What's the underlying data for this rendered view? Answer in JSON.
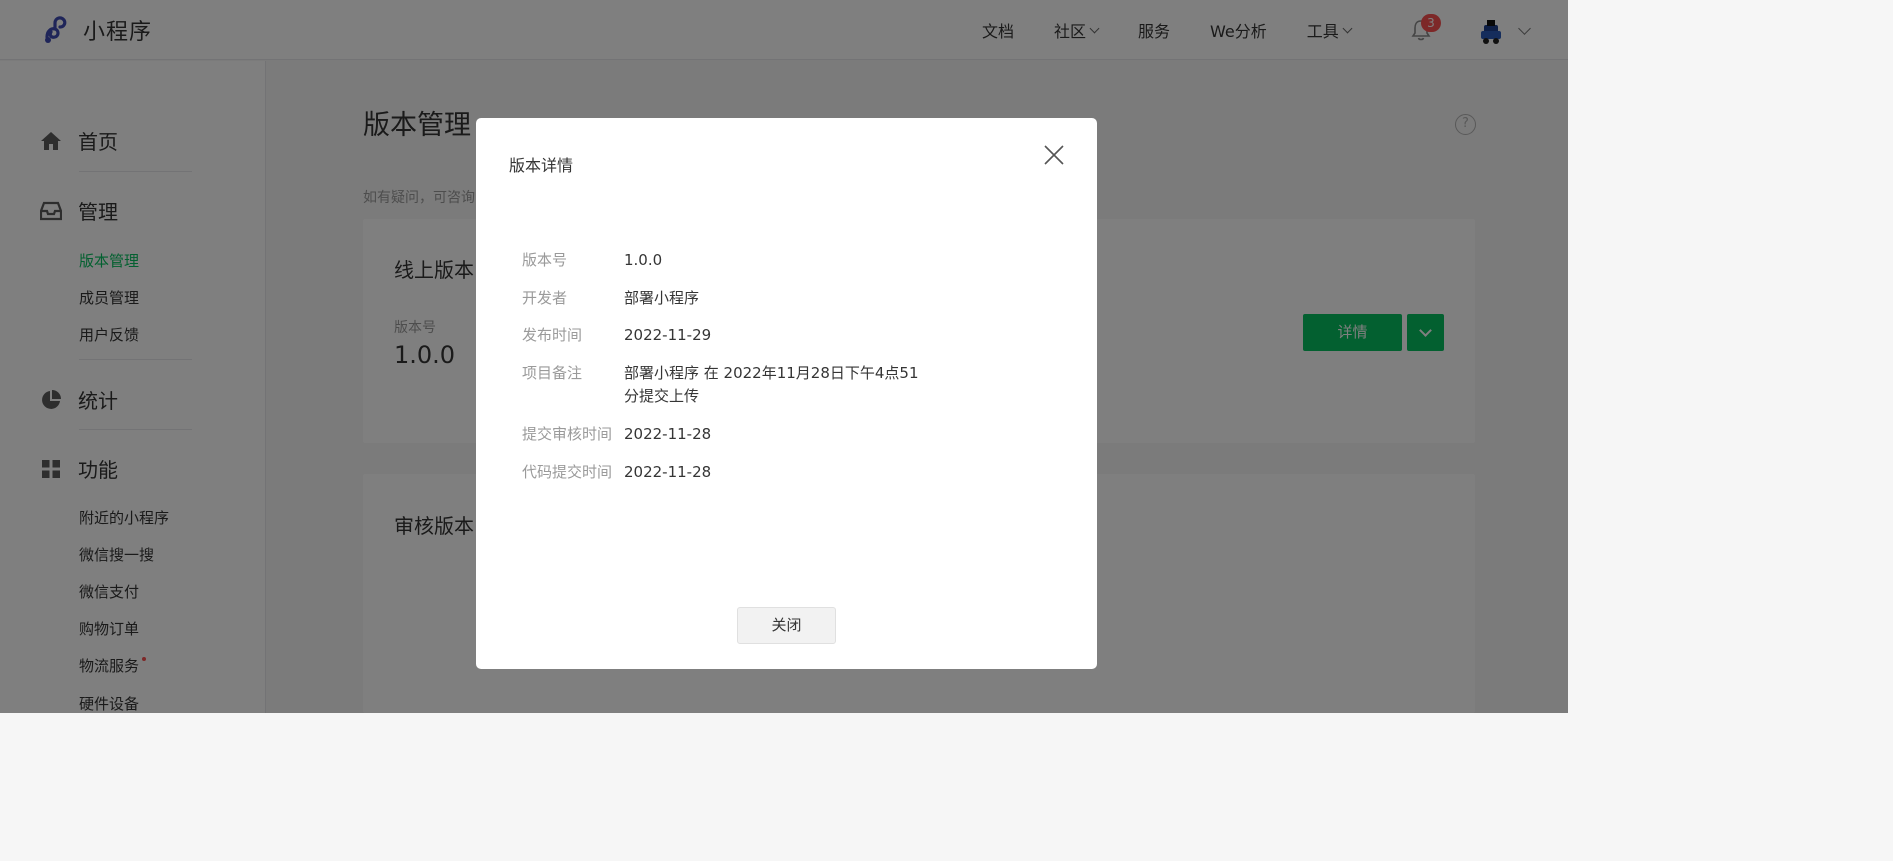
{
  "header": {
    "logo_text": "小程序",
    "nav": [
      "文档",
      "社区",
      "服务",
      "We分析",
      "工具"
    ],
    "notification_count": "3",
    "icons": {
      "logo": "miniprogram-logo-icon",
      "bell": "bell-icon"
    }
  },
  "sidebar": {
    "groups": [
      {
        "label": "首页",
        "icon": "home-icon"
      },
      {
        "label": "管理",
        "icon": "inbox-icon"
      },
      {
        "label": "统计",
        "icon": "pie-chart-icon"
      },
      {
        "label": "功能",
        "icon": "grid-icon"
      }
    ],
    "manage_items": [
      "版本管理",
      "成员管理",
      "用户反馈"
    ],
    "feature_items": [
      "附近的小程序",
      "微信搜一搜",
      "微信支付",
      "购物订单",
      "物流服务",
      "硬件设备"
    ]
  },
  "main": {
    "title": "版本管理",
    "tip": "如有疑问，可咨询",
    "online_card": {
      "title": "线上版本",
      "version_label": "版本号",
      "version_value": "1.0.0",
      "detail_button": "详情"
    },
    "review_card": {
      "title": "审核版本"
    }
  },
  "dialog": {
    "title": "版本详情",
    "rows": [
      {
        "label": "版本号",
        "value": "1.0.0"
      },
      {
        "label": "开发者",
        "value": "部署小程序"
      },
      {
        "label": "发布时间",
        "value": "2022-11-29"
      },
      {
        "label": "项目备注",
        "value": "部署小程序 在 2022年11月28日下午4点51分提交上传"
      },
      {
        "label": "提交审核时间",
        "value": "2022-11-28"
      },
      {
        "label": "代码提交时间",
        "value": "2022-11-28"
      }
    ],
    "close_button": "关闭"
  },
  "colors": {
    "accent": "#07c160",
    "badge": "#fa5151",
    "overlay": "rgba(0,0,0,0.5)"
  }
}
